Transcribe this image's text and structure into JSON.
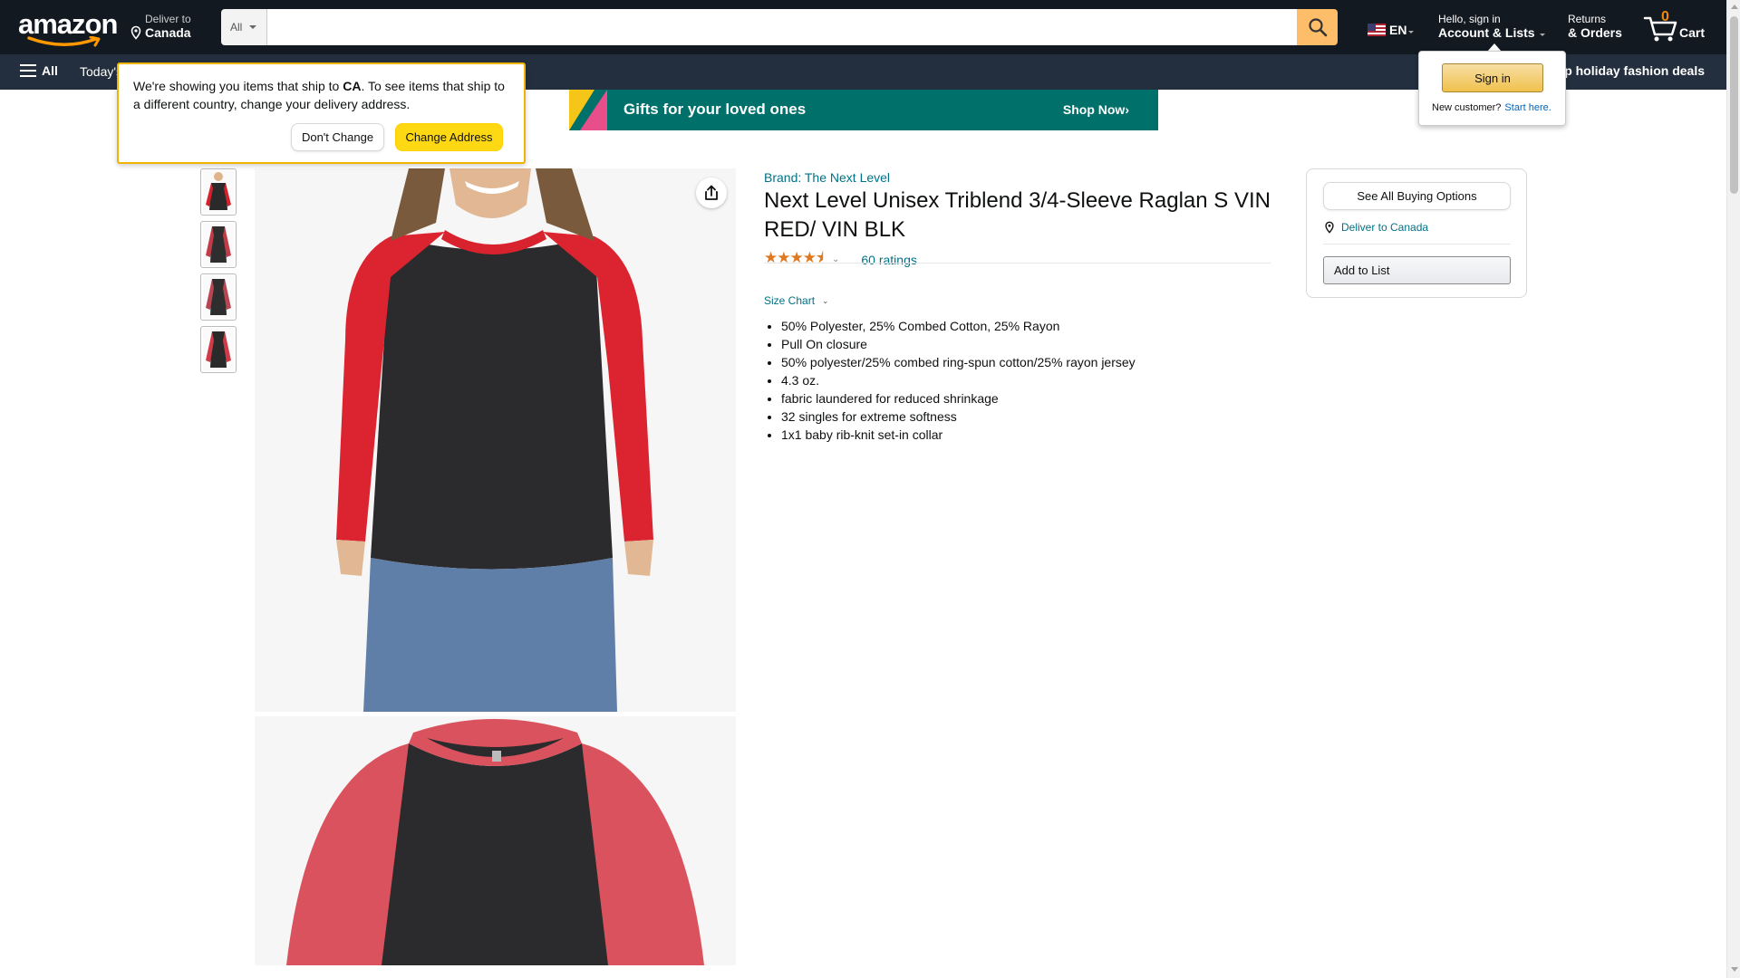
{
  "header": {
    "logo_text": "amazon",
    "deliver_line1": "Deliver to",
    "deliver_line2": "Canada",
    "search": {
      "category": "All",
      "placeholder": "",
      "value": ""
    },
    "language": "EN",
    "account_line1": "Hello, sign in",
    "account_line2": "Account & Lists",
    "returns_line1": "Returns",
    "returns_line2": "& Orders",
    "cart_count": "0",
    "cart_label": "Cart",
    "colors": {
      "nav_bg": "#131921",
      "subnav_bg": "#232f3e",
      "search_button": "#febd69",
      "cart_count": "#f08804"
    }
  },
  "subnav": {
    "all_label": "All",
    "todays_label": "Today's",
    "holiday_label": "p holiday fashion deals"
  },
  "banner": {
    "text": "Gifts for your loved ones",
    "cta": "Shop Now›"
  },
  "address_popover": {
    "text_before": "We're showing you items that ship to ",
    "country_code": "CA",
    "text_after": ". To see items that ship to a different country, change your delivery address.",
    "dont_change": "Don't Change",
    "change_address": "Change Address"
  },
  "signin_popover": {
    "button": "Sign in",
    "new_customer": "New customer?",
    "start_here": "Start here."
  },
  "product": {
    "brand": "Brand: The Next Level",
    "title": "Next Level Unisex Triblend 3/4-Sleeve Raglan S VIN RED/ VIN BLK",
    "rating": 4.5,
    "stars_text": "★★★★⯨",
    "ratings_count": "60 ratings",
    "size_chart": "Size Chart",
    "bullets": [
      "50% Polyester, 25% Combed Cotton, 25% Rayon",
      "Pull On closure",
      "50% polyester/25% combed ring-spun cotton/25% rayon jersey",
      "4.3 oz.",
      "fabric laundered for reduced shrinkage",
      "32 singles for extreme softness",
      "1x1 baby rib-knit set-in collar"
    ],
    "thumbnail_count": 4
  },
  "buybox": {
    "see_all": "See All Buying Options",
    "deliver": "Deliver to Canada",
    "add_to_list": "Add to List"
  }
}
